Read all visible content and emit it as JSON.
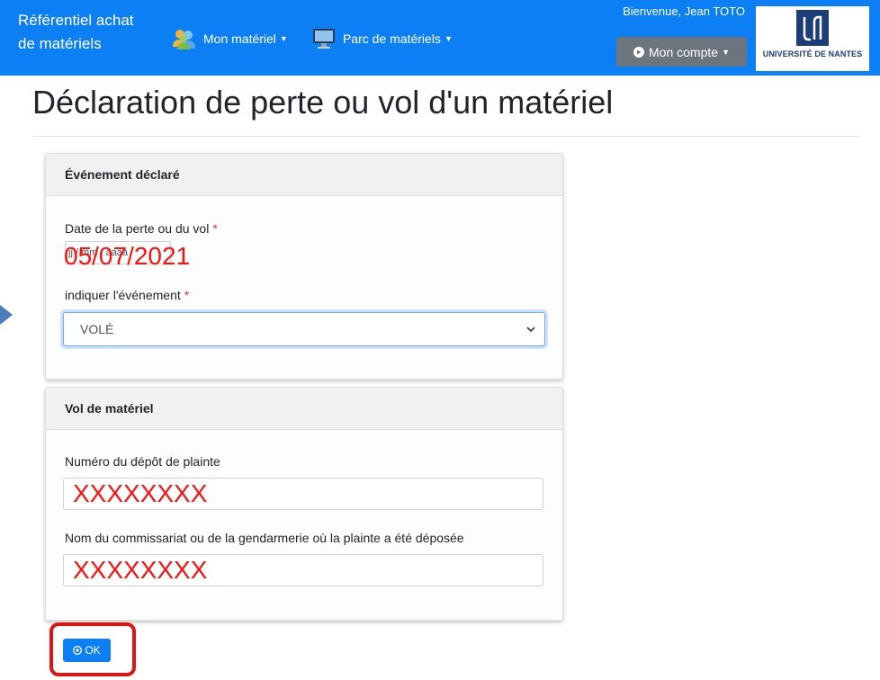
{
  "navbar": {
    "brand_line1": "Référentiel achat",
    "brand_line2": "de matériels",
    "menu_mon_materiel": "Mon matériel",
    "menu_parc": "Parc de matériels",
    "welcome": "Bienvenue, Jean TOTO",
    "account_label": "Mon compte",
    "logo_text": "UNIVERSITÉ DE NANTES",
    "background_color": "#0d7ff4"
  },
  "page": {
    "title": "Déclaration de perte ou vol d'un matériel"
  },
  "event_card": {
    "header": "Événement déclaré",
    "date_label": "Date de la perte ou du vol",
    "date_placeholder": "jj / mm / aaaa",
    "date_value": "05/07/2021",
    "event_label": "indiquer l'événement",
    "event_selected": "VOLÉ",
    "required_marker": "*"
  },
  "theft_card": {
    "header": "Vol de matériel",
    "complaint_label": "Numéro du dépôt de plainte",
    "complaint_value": "XXXXXXXX",
    "station_label": "Nom du commissariat ou de la gendarmerie où la plainte a été déposée",
    "station_value": "XXXXXXXX"
  },
  "actions": {
    "ok_label": "OK"
  },
  "icons": {
    "users": "users-icon",
    "monitor": "monitor-icon",
    "account": "circle-arrow-icon",
    "select": "chevron-down-icon"
  },
  "colors": {
    "primary": "#0d7ff4",
    "secondary": "#6c757d",
    "annotation_red": "#ff1010",
    "required_red": "#dc3545"
  }
}
